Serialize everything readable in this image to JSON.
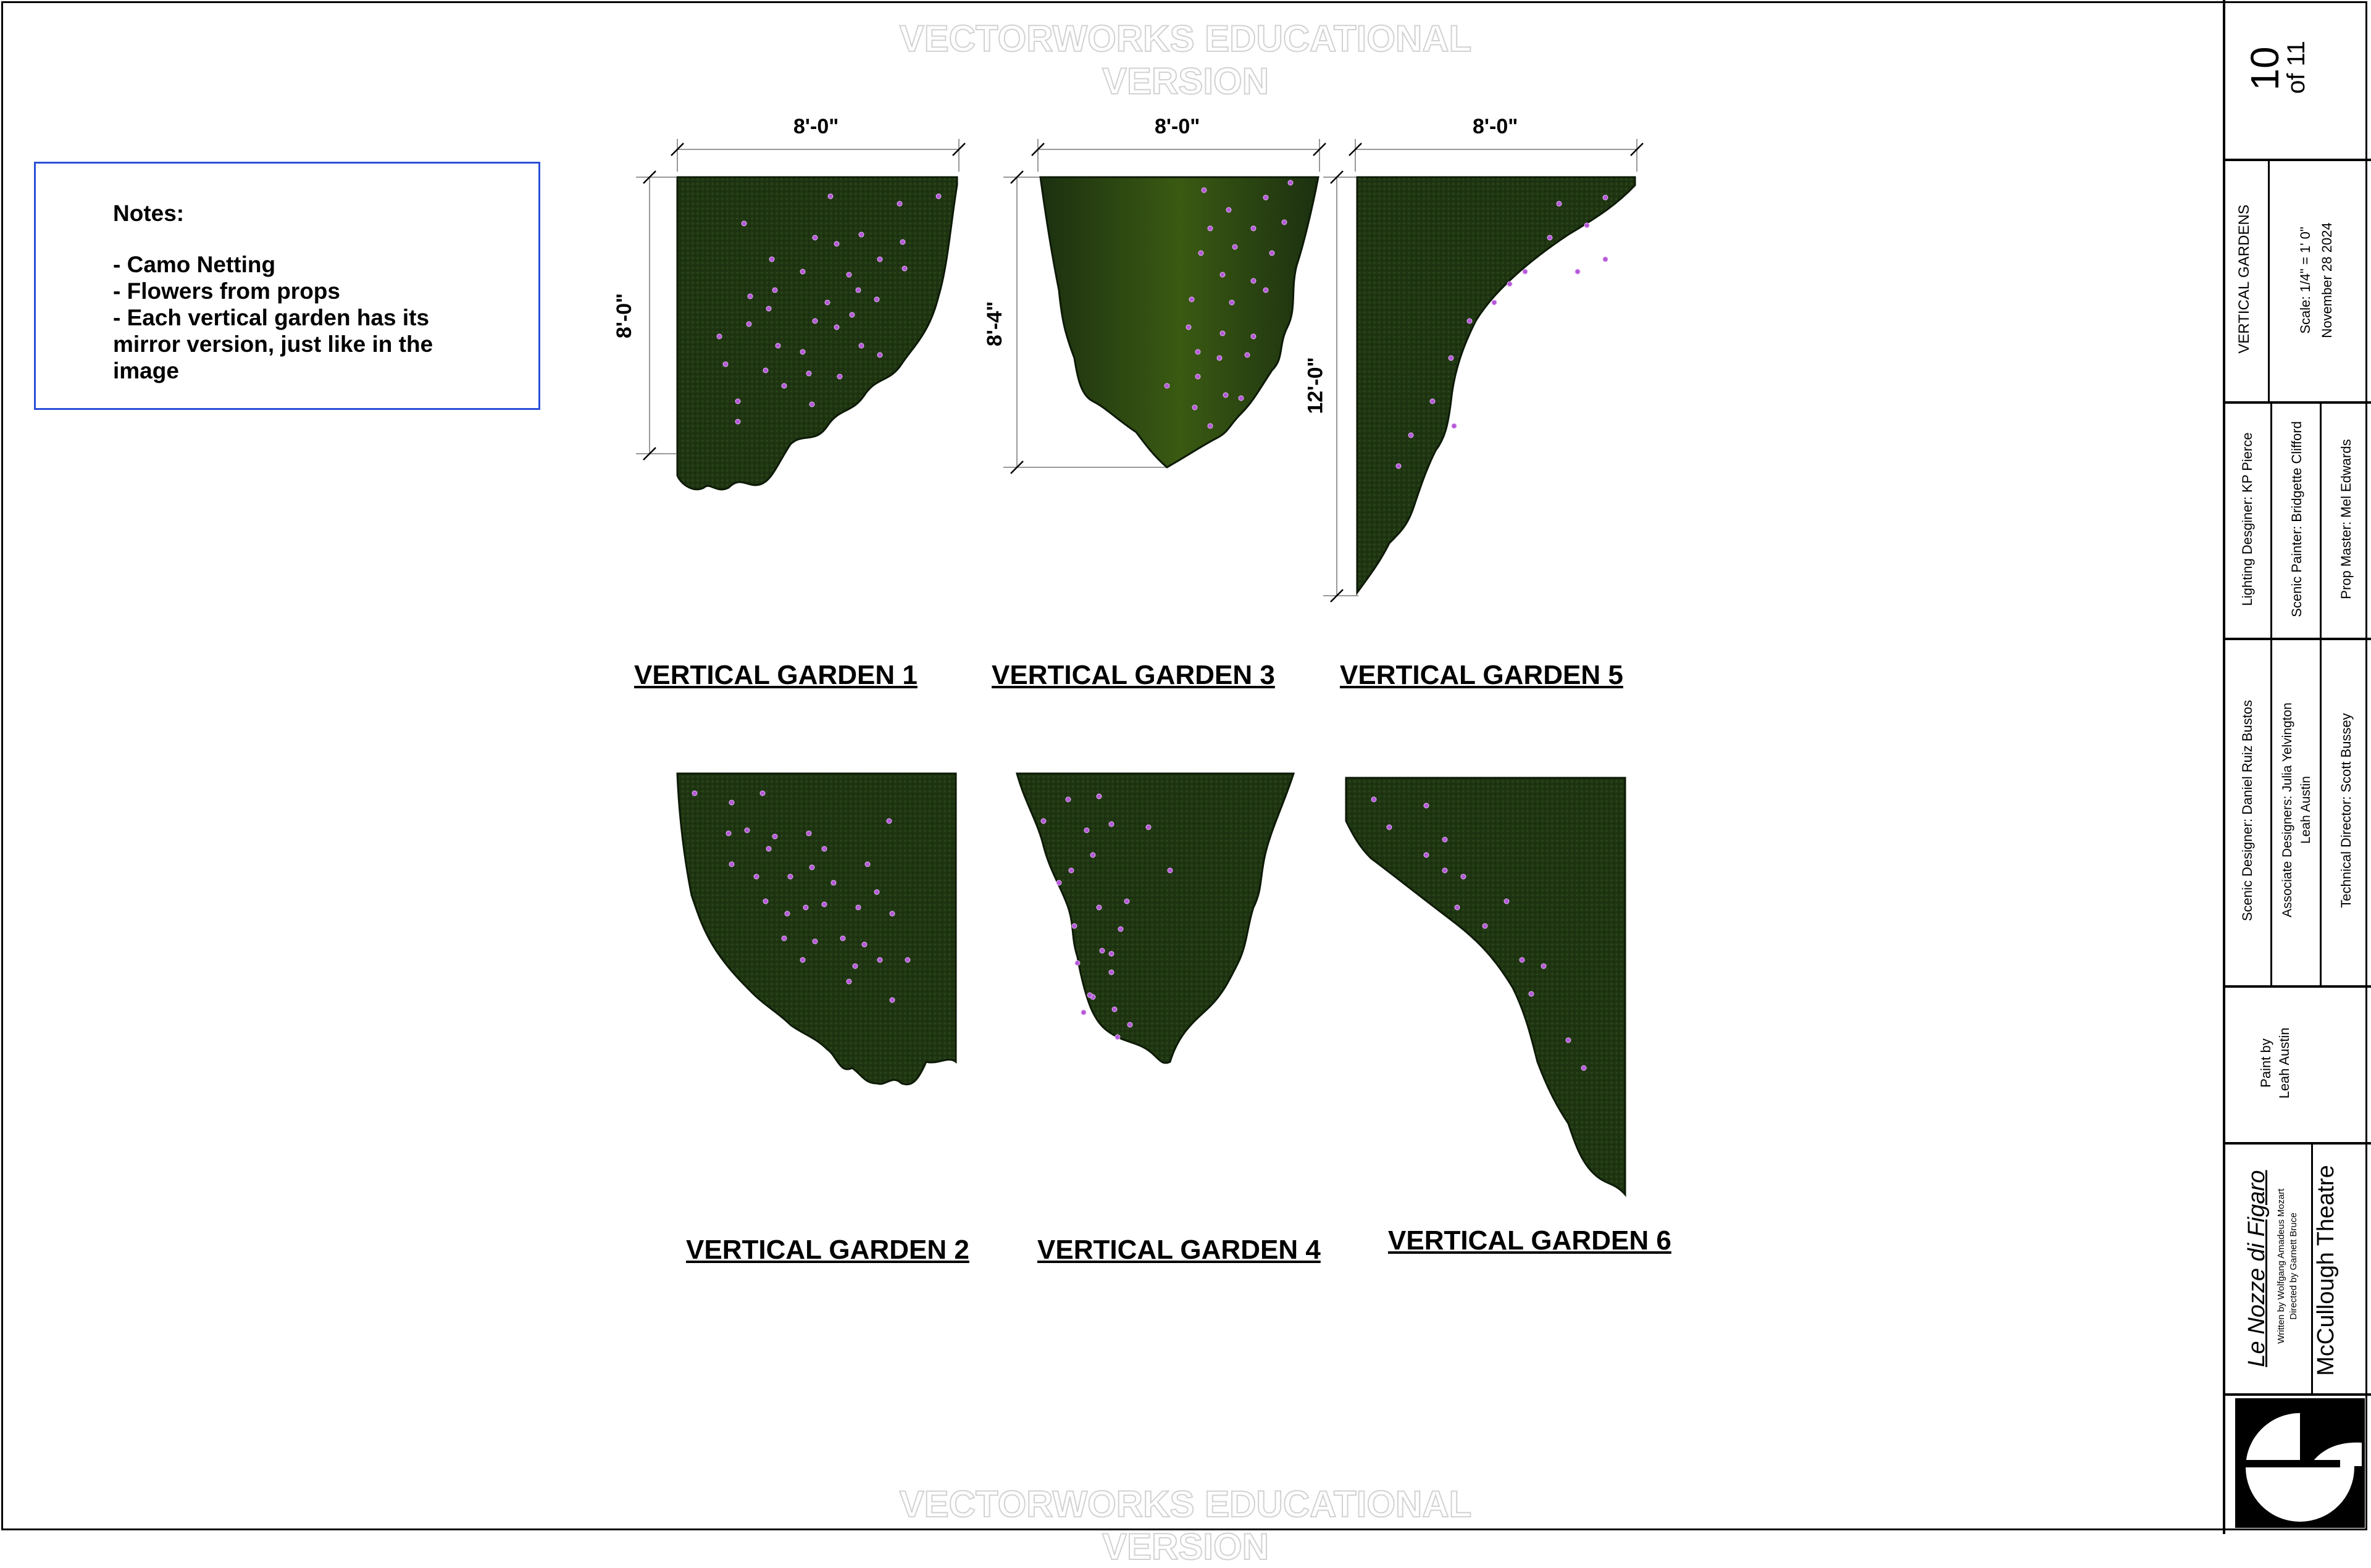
{
  "watermark": "VECTORWORKS EDUCATIONAL VERSION",
  "notes": {
    "title": "Notes:",
    "items": [
      "- Camo Netting",
      "- Flowers from props",
      "- Each vertical garden has its mirror version, just like in the image"
    ]
  },
  "gardens": {
    "g1": {
      "label": "VERTICAL GARDEN 1",
      "width": "8'-0\"",
      "height": "8'-0\""
    },
    "g3": {
      "label": "VERTICAL GARDEN 3",
      "width": "8'-0\"",
      "height": "8'-4\""
    },
    "g5": {
      "label": "VERTICAL GARDEN 5",
      "width": "8'-0\"",
      "height": "12'-0\""
    },
    "g2": {
      "label": "VERTICAL GARDEN 2"
    },
    "g4": {
      "label": "VERTICAL GARDEN 4"
    },
    "g6": {
      "label": "VERTICAL GARDEN 6"
    }
  },
  "colors": {
    "foliage": "#1f3512",
    "foliage_light": "#2f4a16",
    "flower": "#b45ad8",
    "notes_border": "#2a4fd8"
  },
  "title_block": {
    "sheet_number": "10",
    "sheet_total": "of 11",
    "sheet_title": "VERTICAL GARDENS",
    "scale": "Scale: 1/4\" = 1' 0\"",
    "date": "November 28  2024",
    "lighting_designer": "Lighting Desginer: KP Pierce",
    "scenic_painter": "Scenic Painter: Bridgette Clifford",
    "prop_master": "Prop Master: Mel Edwards",
    "scenic_designer": "Scenic Designer: Daniel Ruiz Bustos",
    "associate_designers": "Associate Designers: Julia Yelvington",
    "associate_designers_2": "Leah Austin",
    "technical_director": "Technical Director: Scott Bussey",
    "paint_by": "Paint by",
    "paint_by_name": "Leah Austin",
    "show_title": "Le Nozze di Figaro",
    "written_by": "Written by Wolfgang Amadeus Mozart",
    "directed_by": "Directed by Garnett Bruce",
    "theatre": "McCullough Theatre",
    "logo": "theatre-logo"
  }
}
